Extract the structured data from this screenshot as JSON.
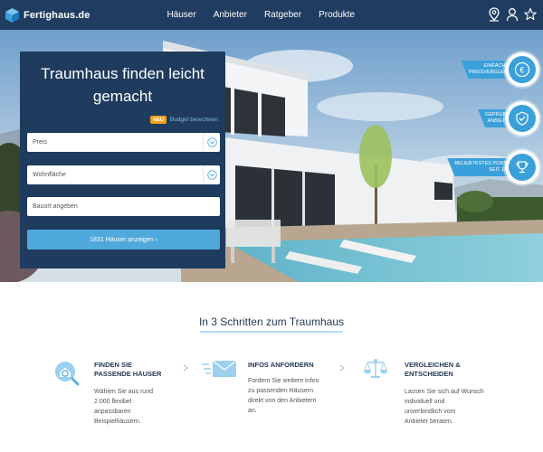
{
  "header": {
    "logo_text": "Fertighaus.de",
    "nav": [
      "Häuser",
      "Anbieter",
      "Ratgeber",
      "Produkte"
    ],
    "icons": [
      "location-pin-icon",
      "user-icon",
      "star-icon"
    ]
  },
  "search_panel": {
    "title": "Traumhaus finden leicht gemacht",
    "badge_new": "NEU",
    "budget_link": "Budget berechnen",
    "price_placeholder": "Preis",
    "area_placeholder": "Wohnfläche",
    "location_placeholder": "Bauort angeben",
    "submit_label": "1831 Häuser anzeigen ›"
  },
  "usps": [
    {
      "line1": "EINFACHER",
      "line2": "PREISVERGLEICH",
      "icon": "euro-coin-icon"
    },
    {
      "line1": "GEPRÜFTE",
      "line2": "ANBIETER",
      "icon": "shield-check-icon"
    },
    {
      "line1": "BELIEBTESTES PORTAL",
      "line2": "SEIT 1996",
      "icon": "trophy-icon"
    }
  ],
  "steps_section": {
    "title": "In 3 Schritten zum Traumhaus",
    "steps": [
      {
        "title1": "FINDEN SIE",
        "title2": "PASSENDE HÄUSER",
        "text": [
          "Wählen Sie aus rund",
          "2.000 flexibel",
          "anpassbaren",
          "Beispielhäusern."
        ],
        "icon": "house-search-icon"
      },
      {
        "title1": "INFOS ANFORDERN",
        "title2": "",
        "text": [
          "Fordern Sie weitere Infos",
          "zu passenden Häusern",
          "direkt von den Anbietern",
          "an."
        ],
        "icon": "mail-icon"
      },
      {
        "title1": "VERGLEICHEN &",
        "title2": "ENTSCHEIDEN",
        "text": [
          "Lassen Sie sich auf Wunsch",
          "individuell und",
          "unverbindlich vom",
          "Anbieter beraten."
        ],
        "icon": "scale-icon"
      }
    ]
  },
  "colors": {
    "navy": "#203c60",
    "accent": "#3aa0da",
    "button": "#4fa9dd",
    "new_badge": "#f4a11d"
  }
}
